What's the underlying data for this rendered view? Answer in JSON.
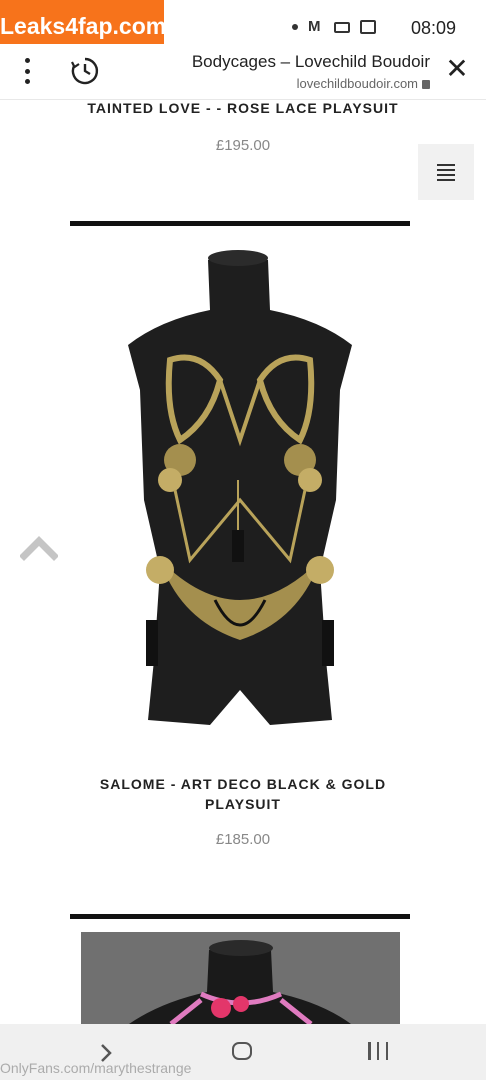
{
  "watermark": {
    "text": "Leaks4fap.com"
  },
  "status_bar": {
    "time": "08:09"
  },
  "browser": {
    "page_title": "Bodycages – Lovechild Boudoir",
    "url": "lovechildboudoir.com",
    "close_icon": "close-icon",
    "history_icon": "history-icon",
    "more_icon": "more-vert-icon"
  },
  "products": [
    {
      "name": "TAINTED LOVE - - ROSE LACE PLAYSUIT",
      "price": "£195.00"
    },
    {
      "name_line1": "SALOME - ART DECO BLACK & GOLD",
      "name_line2": "PLAYSUIT",
      "price": "£185.00"
    }
  ],
  "credit": {
    "text": "OnlyFans.com/marythestrange"
  }
}
